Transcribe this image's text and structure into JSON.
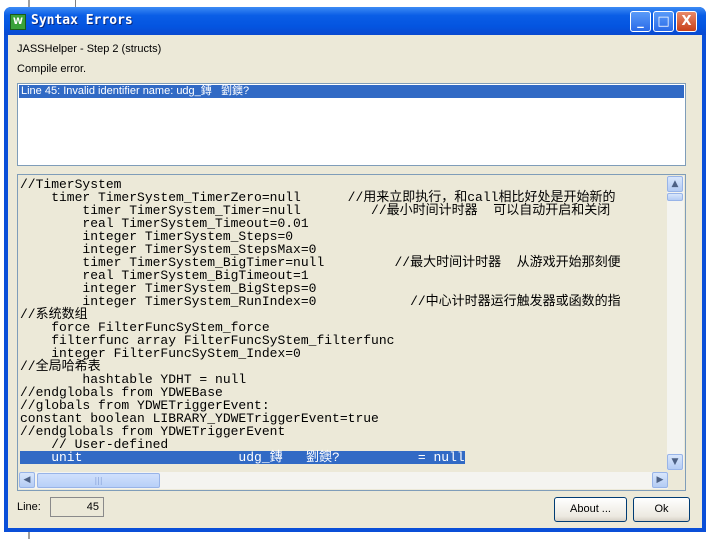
{
  "window": {
    "title": "Syntax Errors",
    "controls": {
      "minimize": "_",
      "maximize": "□",
      "close": "X"
    }
  },
  "header": {
    "step": "JASSHelper - Step 2 (structs)",
    "status": "Compile error."
  },
  "errors": [
    "Line 45: Invalid identifier name: udg_鏄   劉鐭?"
  ],
  "code_lines": [
    "//TimerSystem",
    "    timer TimerSystem_TimerZero=null      //用来立即执行，和call相比好处是开始新的",
    "        timer TimerSystem_Timer=null         //最小时间计时器  可以自动开启和关闭",
    "        real TimerSystem_Timeout=0.01",
    "        integer TimerSystem_Steps=0",
    "        integer TimerSystem_StepsMax=0",
    "        timer TimerSystem_BigTimer=null         //最大时间计时器  从游戏开始那刻便",
    "        real TimerSystem_BigTimeout=1",
    "        integer TimerSystem_BigSteps=0",
    "        integer TimerSystem_RunIndex=0            //中心计时器运行触发器或函数的指",
    "//系统数组",
    "    force FilterFuncSyStem_force",
    "    filterfunc array FilterFuncSyStem_filterfunc",
    "    integer FilterFuncSyStem_Index=0",
    "//全局哈希表",
    "        hashtable YDHT = null",
    "//endglobals from YDWEBase",
    "//globals from YDWETriggerEvent:",
    "constant boolean LIBRARY_YDWETriggerEvent=true",
    "//endglobals from YDWETriggerEvent",
    "    // User-defined"
  ],
  "selected_code_line": "    unit                    udg_鏄   劉鐭?          = null",
  "footer": {
    "line_label": "Line:",
    "line_value": "45",
    "about_label": "About ...",
    "ok_label": "Ok"
  },
  "colors": {
    "selection": "#316ac5",
    "titlebar": "#0a5ee6",
    "dialog_bg": "#ece9d8"
  }
}
